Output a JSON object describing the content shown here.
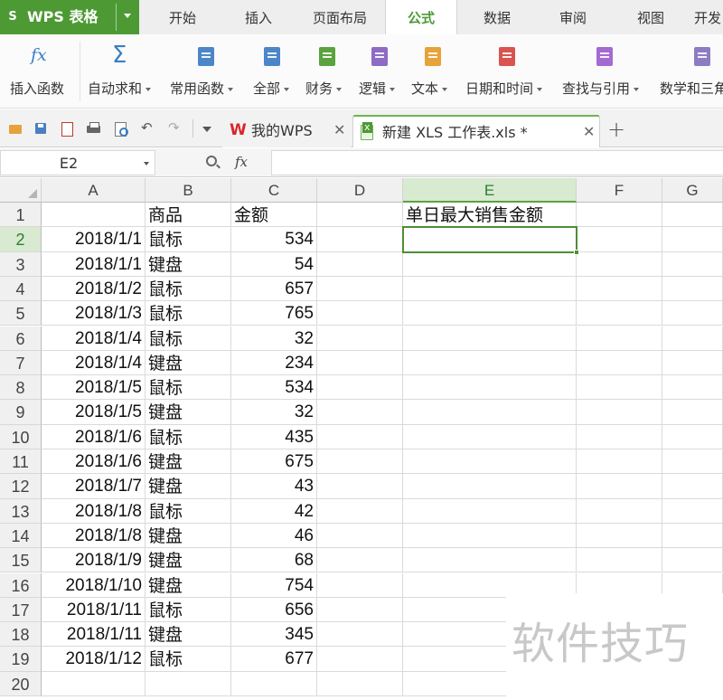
{
  "app": {
    "title": "WPS 表格",
    "accent_color": "#4d9a35"
  },
  "menu_tabs": [
    {
      "label": "开始",
      "active": false
    },
    {
      "label": "插入",
      "active": false
    },
    {
      "label": "页面布局",
      "active": false
    },
    {
      "label": "公式",
      "active": true
    },
    {
      "label": "数据",
      "active": false
    },
    {
      "label": "审阅",
      "active": false
    },
    {
      "label": "视图",
      "active": false
    },
    {
      "label": "开发",
      "active": false
    }
  ],
  "ribbon": {
    "insert_function": {
      "label": "插入函数",
      "icon": "fx-icon"
    },
    "autosum": {
      "label": "自动求和",
      "icon": "sigma-icon"
    },
    "groups": [
      {
        "label": "常用函数",
        "icon": "star-book-icon",
        "color": "#4b86c8"
      },
      {
        "label": "全部",
        "icon": "list-book-icon",
        "color": "#4b86c8"
      },
      {
        "label": "财务",
        "icon": "finance-book-icon",
        "color": "#5aa33f"
      },
      {
        "label": "逻辑",
        "icon": "logic-book-icon",
        "color": "#8e6bc4"
      },
      {
        "label": "文本",
        "icon": "text-book-icon",
        "color": "#e8a23a"
      },
      {
        "label": "日期和时间",
        "icon": "clock-book-icon",
        "color": "#d9534f"
      },
      {
        "label": "查找与引用",
        "icon": "search-book-icon",
        "color": "#a56ad1"
      },
      {
        "label": "数学和三角",
        "icon": "math-book-icon",
        "color": "#8e7cc3"
      }
    ]
  },
  "quick_access": {
    "icons": [
      "open-folder-icon",
      "save-icon",
      "export-pdf-icon",
      "print-icon",
      "print-preview-icon",
      "undo-icon",
      "redo-icon",
      "customize-dropdown-icon"
    ]
  },
  "doc_tabs": [
    {
      "title": "我的WPS",
      "active": false
    },
    {
      "title": "新建 XLS 工作表.xls *",
      "active": true
    }
  ],
  "formula_bar": {
    "name_box": "E2",
    "formula": ""
  },
  "sheet": {
    "columns": [
      "A",
      "B",
      "C",
      "D",
      "E",
      "F",
      "G"
    ],
    "selected_column": "E",
    "selected_row": 2,
    "active_cell": "E2",
    "row_numbers": [
      1,
      2,
      3,
      4,
      5,
      6,
      7,
      8,
      9,
      10,
      11,
      12,
      13,
      14,
      15,
      16,
      17,
      18,
      19,
      20
    ],
    "header_row": {
      "B": "商品",
      "C": "金额",
      "E": "单日最大销售金额"
    },
    "rows": [
      {
        "date": "2018/1/1",
        "product": "鼠标",
        "amount": "534"
      },
      {
        "date": "2018/1/1",
        "product": "键盘",
        "amount": "54"
      },
      {
        "date": "2018/1/2",
        "product": "鼠标",
        "amount": "657"
      },
      {
        "date": "2018/1/3",
        "product": "鼠标",
        "amount": "765"
      },
      {
        "date": "2018/1/4",
        "product": "鼠标",
        "amount": "32"
      },
      {
        "date": "2018/1/4",
        "product": "键盘",
        "amount": "234"
      },
      {
        "date": "2018/1/5",
        "product": "鼠标",
        "amount": "534"
      },
      {
        "date": "2018/1/5",
        "product": "键盘",
        "amount": "32"
      },
      {
        "date": "2018/1/6",
        "product": "鼠标",
        "amount": "435"
      },
      {
        "date": "2018/1/6",
        "product": "键盘",
        "amount": "675"
      },
      {
        "date": "2018/1/7",
        "product": "键盘",
        "amount": "43"
      },
      {
        "date": "2018/1/8",
        "product": "鼠标",
        "amount": "42"
      },
      {
        "date": "2018/1/8",
        "product": "键盘",
        "amount": "46"
      },
      {
        "date": "2018/1/9",
        "product": "键盘",
        "amount": "68"
      },
      {
        "date": "2018/1/10",
        "product": "键盘",
        "amount": "754"
      },
      {
        "date": "2018/1/11",
        "product": "鼠标",
        "amount": "656"
      },
      {
        "date": "2018/1/11",
        "product": "键盘",
        "amount": "345"
      },
      {
        "date": "2018/1/12",
        "product": "鼠标",
        "amount": "677"
      }
    ]
  },
  "watermark": "软件技巧"
}
